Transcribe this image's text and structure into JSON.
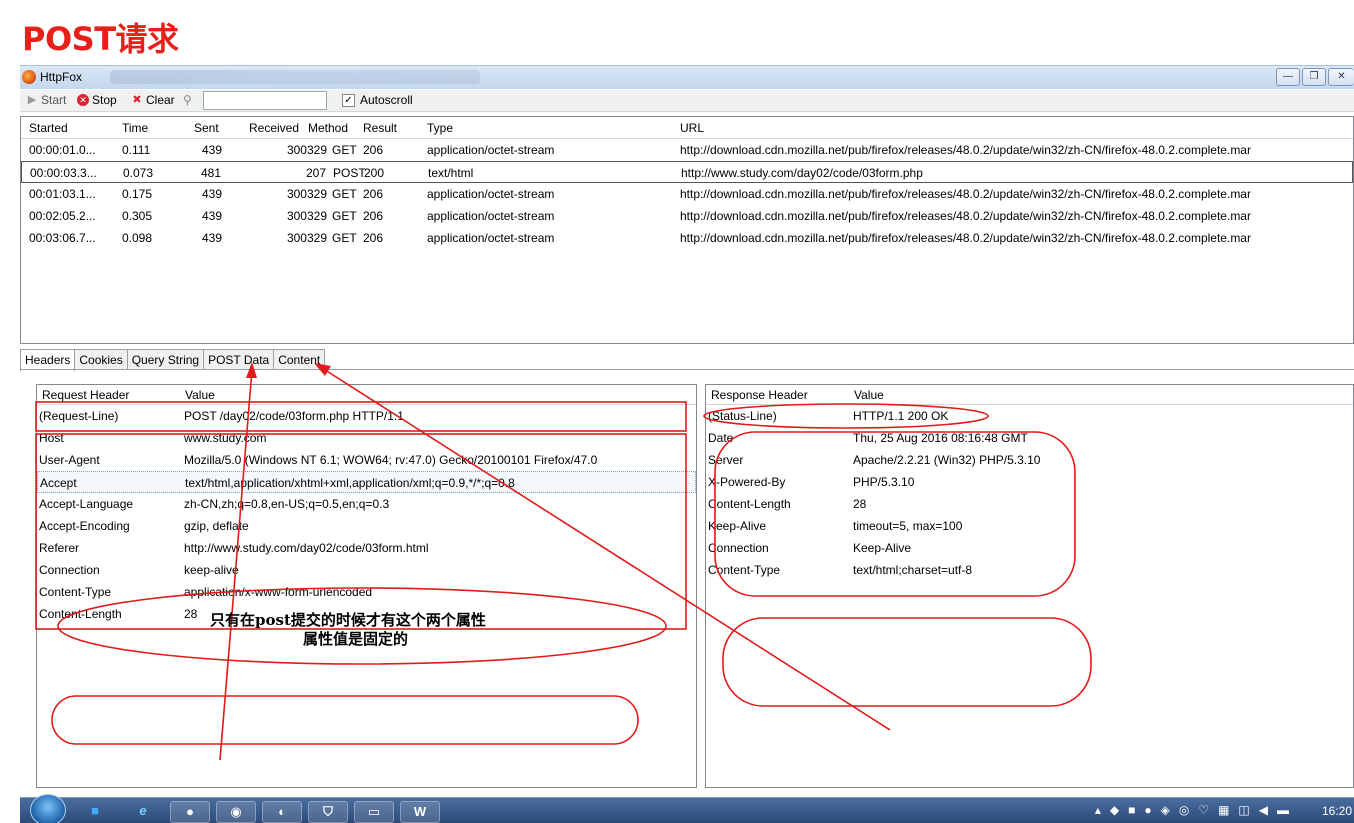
{
  "page_title": "POST请求",
  "window": {
    "title": "HttpFox"
  },
  "toolbar": {
    "start": "Start",
    "stop": "Stop",
    "clear": "Clear",
    "search_value": "",
    "autoscroll": "Autoscroll",
    "autoscroll_checked": true
  },
  "requests": {
    "columns": [
      "Started",
      "Time",
      "Sent",
      "Received",
      "Method",
      "Result",
      "Type",
      "URL"
    ],
    "rows": [
      {
        "started": "00:00:01.0...",
        "time": "0.111",
        "sent": "439",
        "received": "300329",
        "method": "GET",
        "result": "206",
        "type": "application/octet-stream",
        "url": "http://download.cdn.mozilla.net/pub/firefox/releases/48.0.2/update/win32/zh-CN/firefox-48.0.2.complete.mar"
      },
      {
        "started": "00:00:03.3...",
        "time": "0.073",
        "sent": "481",
        "received": "207",
        "method": "POST",
        "result": "200",
        "type": "text/html",
        "url": "http://www.study.com/day02/code/03form.php"
      },
      {
        "started": "00:01:03.1...",
        "time": "0.175",
        "sent": "439",
        "received": "300329",
        "method": "GET",
        "result": "206",
        "type": "application/octet-stream",
        "url": "http://download.cdn.mozilla.net/pub/firefox/releases/48.0.2/update/win32/zh-CN/firefox-48.0.2.complete.mar"
      },
      {
        "started": "00:02:05.2...",
        "time": "0.305",
        "sent": "439",
        "received": "300329",
        "method": "GET",
        "result": "206",
        "type": "application/octet-stream",
        "url": "http://download.cdn.mozilla.net/pub/firefox/releases/48.0.2/update/win32/zh-CN/firefox-48.0.2.complete.mar"
      },
      {
        "started": "00:03:06.7...",
        "time": "0.098",
        "sent": "439",
        "received": "300329",
        "method": "GET",
        "result": "206",
        "type": "application/octet-stream",
        "url": "http://download.cdn.mozilla.net/pub/firefox/releases/48.0.2/update/win32/zh-CN/firefox-48.0.2.complete.mar"
      }
    ]
  },
  "tabs": [
    "Headers",
    "Cookies",
    "Query String",
    "POST Data",
    "Content"
  ],
  "request_headers": {
    "col_name": "Request Header",
    "col_value": "Value",
    "rows": [
      {
        "name": "(Request-Line)",
        "value": "POST /day02/code/03form.php HTTP/1.1"
      },
      {
        "name": "Host",
        "value": "www.study.com"
      },
      {
        "name": "User-Agent",
        "value": "Mozilla/5.0 (Windows NT 6.1; WOW64; rv:47.0) Gecko/20100101 Firefox/47.0"
      },
      {
        "name": "Accept",
        "value": "text/html,application/xhtml+xml,application/xml;q=0.9,*/*;q=0.8"
      },
      {
        "name": "Accept-Language",
        "value": "zh-CN,zh;q=0.8,en-US;q=0.5,en;q=0.3"
      },
      {
        "name": "Accept-Encoding",
        "value": "gzip, deflate"
      },
      {
        "name": "Referer",
        "value": "http://www.study.com/day02/code/03form.html"
      },
      {
        "name": "Connection",
        "value": "keep-alive"
      },
      {
        "name": "Content-Type",
        "value": "application/x-www-form-urlencoded"
      },
      {
        "name": "Content-Length",
        "value": "28"
      }
    ]
  },
  "response_headers": {
    "col_name": "Response Header",
    "col_value": "Value",
    "rows": [
      {
        "name": "(Status-Line)",
        "value": "HTTP/1.1 200 OK"
      },
      {
        "name": "Date",
        "value": "Thu, 25 Aug 2016 08:16:48 GMT"
      },
      {
        "name": "Server",
        "value": "Apache/2.2.21 (Win32) PHP/5.3.10"
      },
      {
        "name": "X-Powered-By",
        "value": "PHP/5.3.10"
      },
      {
        "name": "Content-Length",
        "value": "28"
      },
      {
        "name": "Keep-Alive",
        "value": "timeout=5, max=100"
      },
      {
        "name": "Connection",
        "value": "Keep-Alive"
      },
      {
        "name": "Content-Type",
        "value": "text/html;charset=utf-8"
      }
    ]
  },
  "annotation": {
    "line1": "只有在post提交的时候才有这个两个属性",
    "line2": "属性值是固定的",
    "color": "#e11a1a"
  },
  "taskbar": {
    "clock": "16:20"
  }
}
